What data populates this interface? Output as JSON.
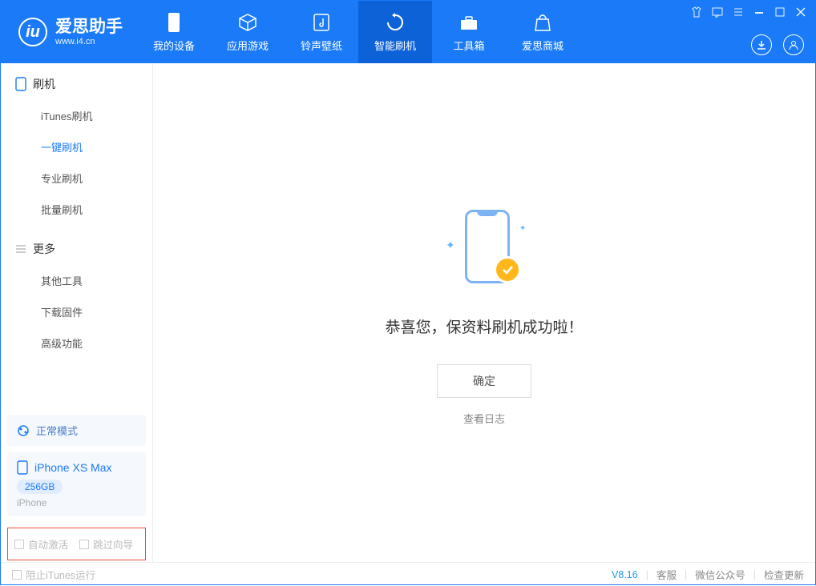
{
  "header": {
    "app_name": "爱思助手",
    "app_url": "www.i4.cn",
    "tabs": [
      {
        "label": "我的设备",
        "key": "device"
      },
      {
        "label": "应用游戏",
        "key": "apps"
      },
      {
        "label": "铃声壁纸",
        "key": "ring"
      },
      {
        "label": "智能刷机",
        "key": "flash"
      },
      {
        "label": "工具箱",
        "key": "tools"
      },
      {
        "label": "爱思商城",
        "key": "store"
      }
    ]
  },
  "sidebar": {
    "group1": {
      "title": "刷机",
      "items": [
        "iTunes刷机",
        "一键刷机",
        "专业刷机",
        "批量刷机"
      ],
      "active": 1
    },
    "group2": {
      "title": "更多",
      "items": [
        "其他工具",
        "下载固件",
        "高级功能"
      ]
    }
  },
  "device": {
    "mode": "正常模式",
    "name": "iPhone XS Max",
    "capacity": "256GB",
    "line": "iPhone"
  },
  "bottom_checks": {
    "auto_activate": "自动激活",
    "skip_wizard": "跳过向导"
  },
  "main": {
    "message": "恭喜您，保资料刷机成功啦！",
    "ok": "确定",
    "view_log": "查看日志"
  },
  "footer": {
    "block_itunes": "阻止iTunes运行",
    "version": "V8.16",
    "links": [
      "客服",
      "微信公众号",
      "检查更新"
    ]
  }
}
